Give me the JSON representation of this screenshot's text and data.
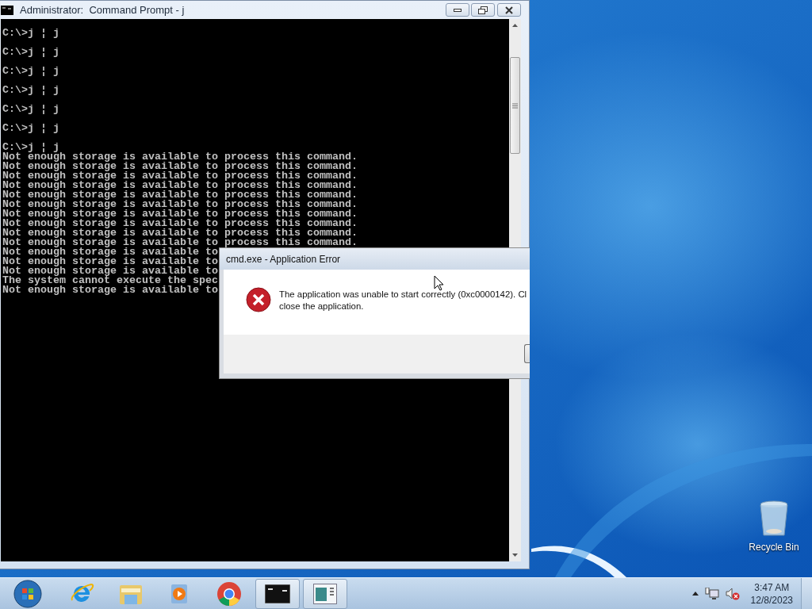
{
  "window": {
    "title": "Administrator:  Command Prompt - j"
  },
  "console": {
    "lines": [
      {
        "kind": "prompt",
        "text": "C:\\>j ¦ j"
      },
      {
        "kind": "prompt",
        "text": "C:\\>j ¦ j"
      },
      {
        "kind": "prompt",
        "text": "C:\\>j ¦ j"
      },
      {
        "kind": "prompt",
        "text": "C:\\>j ¦ j"
      },
      {
        "kind": "prompt",
        "text": "C:\\>j ¦ j"
      },
      {
        "kind": "prompt",
        "text": "C:\\>j ¦ j"
      },
      {
        "kind": "prompt",
        "text": "C:\\>j ¦ j"
      },
      {
        "kind": "output",
        "text": "Not enough storage is available to process this command."
      },
      {
        "kind": "output",
        "text": "Not enough storage is available to process this command."
      },
      {
        "kind": "output",
        "text": "Not enough storage is available to process this command."
      },
      {
        "kind": "output",
        "text": "Not enough storage is available to process this command."
      },
      {
        "kind": "output",
        "text": "Not enough storage is available to process this command."
      },
      {
        "kind": "output",
        "text": "Not enough storage is available to process this command."
      },
      {
        "kind": "output",
        "text": "Not enough storage is available to process this command."
      },
      {
        "kind": "output",
        "text": "Not enough storage is available to process this command."
      },
      {
        "kind": "output",
        "text": "Not enough storage is available to process this command."
      },
      {
        "kind": "output",
        "text": "Not enough storage is available to process this command."
      },
      {
        "kind": "output",
        "text": "Not enough storage is available to"
      },
      {
        "kind": "output",
        "text": "Not enough storage is available to"
      },
      {
        "kind": "output",
        "text": "Not enough storage is available to"
      },
      {
        "kind": "output",
        "text": "The system cannot execute the spec"
      },
      {
        "kind": "output",
        "text": "Not enough storage is available to"
      }
    ]
  },
  "dialog": {
    "title": "cmd.exe - Application Error",
    "message_lines": [
      "The application was unable to start correctly (0xc0000142). Cl",
      "close the application."
    ]
  },
  "desktop_icons": [
    {
      "label": "Recycle Bin"
    }
  ],
  "taskbar": {
    "items": [
      {
        "kind": "ie",
        "open": false
      },
      {
        "kind": "explorer",
        "open": false
      },
      {
        "kind": "media",
        "open": false
      },
      {
        "kind": "chrome",
        "open": false
      },
      {
        "kind": "cmd",
        "open": true
      },
      {
        "kind": "app",
        "open": true
      }
    ],
    "clock": {
      "time": "3:47 AM",
      "date": "12/8/2023"
    }
  }
}
